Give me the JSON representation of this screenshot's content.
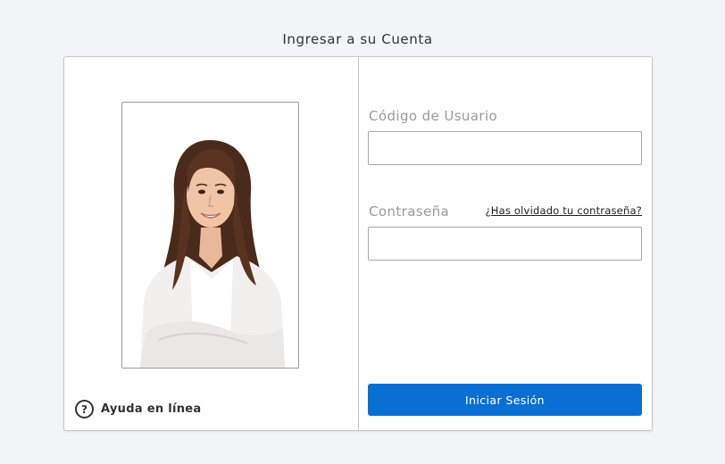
{
  "page_title": "Ingresar a su Cuenta",
  "help": {
    "icon": "question-circle-icon",
    "icon_glyph": "?",
    "label": "Ayuda en línea"
  },
  "form": {
    "user_label": "Código de Usuario",
    "user_value": "",
    "password_label": "Contraseña",
    "password_value": "",
    "forgot_link": "¿Has olvidado tu contraseña?",
    "submit_label": "Iniciar Sesión"
  },
  "colors": {
    "page_background": "#f3f4f6",
    "primary_button": "#0a6fd3",
    "label_gray": "#9a9a9a",
    "border": "#c6c6c6"
  }
}
